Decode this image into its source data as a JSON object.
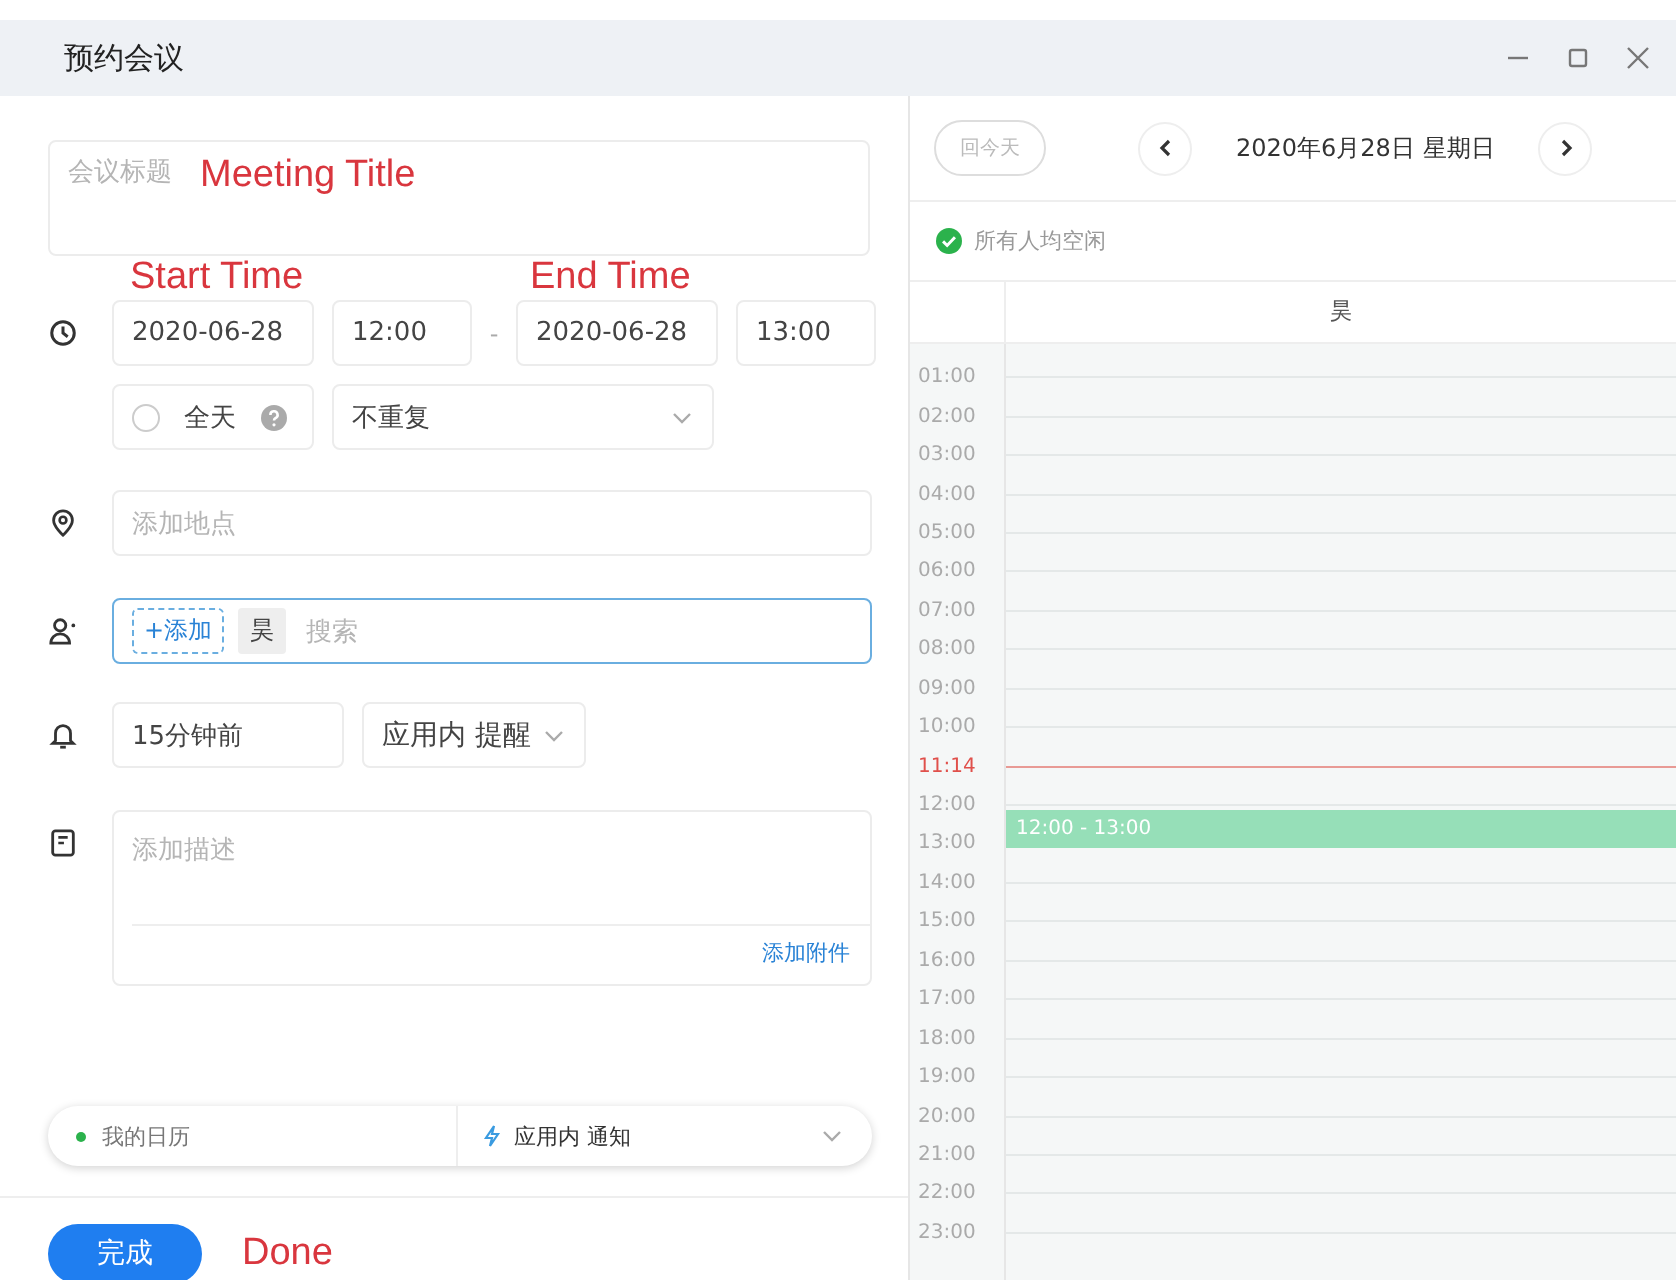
{
  "window": {
    "title": "预约会议"
  },
  "form": {
    "title_placeholder": "会议标题",
    "title_note": "Meeting Title",
    "start_note": "Start Time",
    "end_note": "End Time",
    "start_date": "2020-06-28",
    "start_time": "12:00",
    "separator": "-",
    "end_date": "2020-06-28",
    "end_time": "13:00",
    "all_day": {
      "label": "全天",
      "checked": false
    },
    "repeat": "不重复",
    "location_placeholder": "添加地点",
    "attendees": {
      "add_button": "+添加",
      "chips": [
        "昊"
      ],
      "placeholder": "搜索"
    },
    "reminder": {
      "time": "15分钟前",
      "method": "应用内 提醒"
    },
    "description_placeholder": "添加描述",
    "attachment_link": "添加附件",
    "calendar": {
      "name": "我的日历",
      "color": "#2bb24c"
    },
    "notify": "应用内 通知",
    "done_button": "完成",
    "done_note": "Done"
  },
  "schedule": {
    "today_button": "回今天",
    "date": "2020年6月28日 星期日",
    "status": "所有人均空闲",
    "columns": [
      "昊"
    ],
    "hours": [
      {
        "label": "01:00",
        "kind": "hour"
      },
      {
        "label": "02:00",
        "kind": "hour"
      },
      {
        "label": "03:00",
        "kind": "hour"
      },
      {
        "label": "04:00",
        "kind": "hour"
      },
      {
        "label": "05:00",
        "kind": "hour"
      },
      {
        "label": "06:00",
        "kind": "hour"
      },
      {
        "label": "07:00",
        "kind": "hour"
      },
      {
        "label": "08:00",
        "kind": "hour"
      },
      {
        "label": "09:00",
        "kind": "hour"
      },
      {
        "label": "10:00",
        "kind": "hour"
      },
      {
        "label": "11:14",
        "kind": "now"
      },
      {
        "label": "12:00",
        "kind": "hour"
      },
      {
        "label": "13:00",
        "kind": "hour"
      },
      {
        "label": "14:00",
        "kind": "hour"
      },
      {
        "label": "15:00",
        "kind": "hour"
      },
      {
        "label": "16:00",
        "kind": "hour"
      },
      {
        "label": "17:00",
        "kind": "hour"
      },
      {
        "label": "18:00",
        "kind": "hour"
      },
      {
        "label": "19:00",
        "kind": "hour"
      },
      {
        "label": "20:00",
        "kind": "hour"
      },
      {
        "label": "21:00",
        "kind": "hour"
      },
      {
        "label": "22:00",
        "kind": "hour"
      },
      {
        "label": "23:00",
        "kind": "hour"
      }
    ],
    "event": {
      "label": "12:00 - 13:00"
    }
  }
}
